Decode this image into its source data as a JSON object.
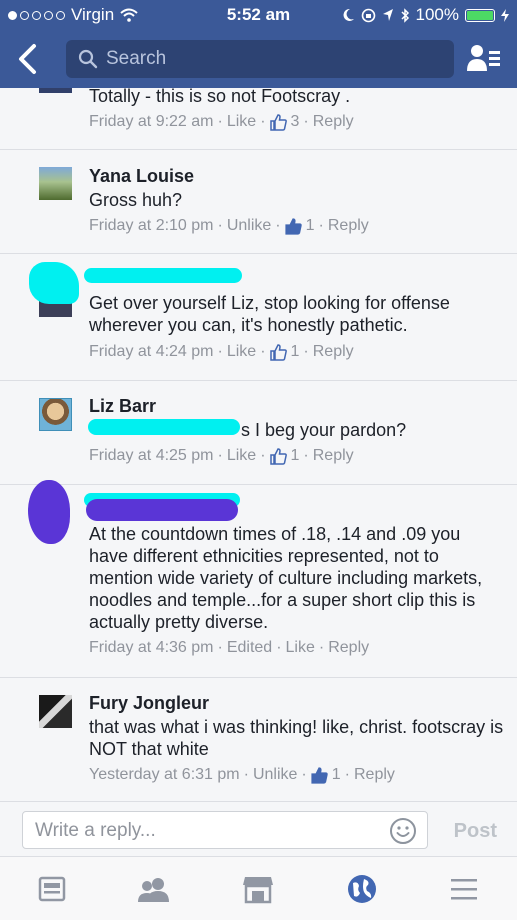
{
  "status_bar": {
    "carrier": "Virgin",
    "time": "5:52 am",
    "battery": "100%"
  },
  "nav": {
    "search_placeholder": "Search"
  },
  "comments": [
    {
      "text": "Totally - this is so not Footscray .",
      "time": "Friday at 9:22 am",
      "like_action": "Like",
      "like_count": "3",
      "reply": "Reply"
    },
    {
      "name": "Yana Louise",
      "text": "Gross huh?",
      "time": "Friday at 2:10 pm",
      "like_action": "Unlike",
      "like_count": "1",
      "reply": "Reply"
    },
    {
      "text": "Get over yourself Liz, stop looking for offense wherever you can, it's honestly pathetic.",
      "time": "Friday at 4:24 pm",
      "like_action": "Like",
      "like_count": "1",
      "reply": "Reply"
    },
    {
      "name": "Liz Barr",
      "text": "s I beg your pardon?",
      "time": "Friday at 4:25 pm",
      "like_action": "Like",
      "like_count": "1",
      "reply": "Reply"
    },
    {
      "text": "At the countdown times of .18, .14 and .09 you have different ethnicities represented, not to mention wide variety of culture including markets, noodles and temple...for a super short clip this is actually pretty diverse.",
      "time": "Friday at 4:36 pm",
      "edited": "Edited",
      "like_action": "Like",
      "reply": "Reply"
    },
    {
      "name": "Fury Jongleur",
      "text": "that was what i was thinking! like, christ. footscray is NOT that white",
      "time": "Yesterday at 6:31 pm",
      "like_action": "Unlike",
      "like_count": "1",
      "reply": "Reply"
    }
  ],
  "composer": {
    "placeholder": "Write a reply...",
    "post_label": "Post"
  },
  "colors": {
    "brand": "#3b5998",
    "like_blue": "#4267b2",
    "scribble_cyan": "#00f0f0",
    "scribble_purple": "#5a35d6"
  }
}
